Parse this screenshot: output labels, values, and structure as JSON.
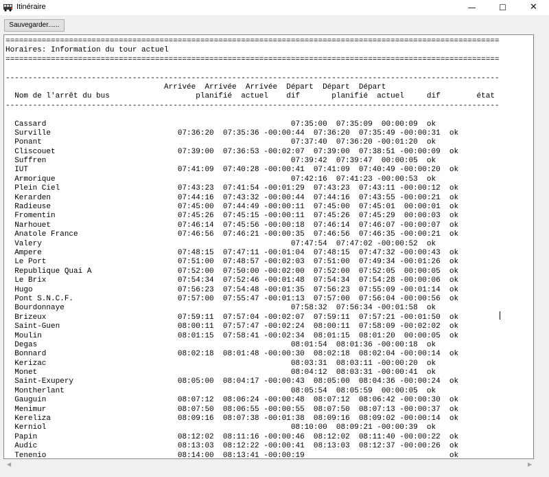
{
  "window": {
    "title": "Itinéraire",
    "minimize": "—",
    "maximize": "☐",
    "close": "✕"
  },
  "toolbar": {
    "save_label": "Sauvegarder......"
  },
  "report": {
    "lines": [
      "=============================================================================================================",
      "Horaires: Information du tour actuel",
      "=============================================================================================================",
      "",
      "-------------------------------------------------------------------------------------------------------------",
      "                                   Arrivée  Arrivée  Arrivée  Départ  Départ  Départ",
      "  Nom de l'arrêt du bus                   planifié  actuel    dif       planifié  actuel     dif        état",
      "-------------------------------------------------------------------------------------------------------------",
      "",
      "  Cassard                                                      07:35:00  07:35:09  00:00:09  ok",
      "  Surville                            07:36:20  07:35:36 -00:00:44  07:36:20  07:35:49 -00:00:31  ok",
      "  Ponant                                                       07:37:40  07:36:20 -00:01:20  ok",
      "  Cliscouet                           07:39:00  07:36:53 -00:02:07  07:39:00  07:38:51 -00:00:09  ok",
      "  Suffren                                                      07:39:42  07:39:47  00:00:05  ok",
      "  IUT                                 07:41:09  07:40:28 -00:00:41  07:41:09  07:40:49 -00:00:20  ok",
      "  Armorique                                                    07:42:16  07:41:23 -00:00:53  ok",
      "  Plein Ciel                          07:43:23  07:41:54 -00:01:29  07:43:23  07:43:11 -00:00:12  ok",
      "  Kerarden                            07:44:16  07:43:32 -00:00:44  07:44:16  07:43:55 -00:00:21  ok",
      "  Radieuse                            07:45:00  07:44:49 -00:00:11  07:45:00  07:45:01  00:00:01  ok",
      "  Fromentin                           07:45:26  07:45:15 -00:00:11  07:45:26  07:45:29  00:00:03  ok",
      "  Narhouet                            07:46:14  07:45:56 -00:00:18  07:46:14  07:46:07 -00:00:07  ok",
      "  Anatole France                      07:46:56  07:46:21 -00:00:35  07:46:56  07:46:35 -00:00:21  ok",
      "  Valery                                                       07:47:54  07:47:02 -00:00:52  ok",
      "  Ampere                              07:48:15  07:47:11 -00:01:04  07:48:15  07:47:32 -00:00:43  ok",
      "  Le Port                             07:51:00  07:48:57 -00:02:03  07:51:00  07:49:34 -00:01:26  ok",
      "  Republique Quai A                   07:52:00  07:50:00 -00:02:00  07:52:00  07:52:05  00:00:05  ok",
      "  Le Brix                             07:54:34  07:52:46 -00:01:48  07:54:34  07:54:28 -00:00:06  ok",
      "  Hugo                                07:56:23  07:54:48 -00:01:35  07:56:23  07:55:09 -00:01:14  ok",
      "  Pont S.N.C.F.                       07:57:00  07:55:47 -00:01:13  07:57:00  07:56:04 -00:00:56  ok",
      "  Bourdonnaye                                                  07:58:32  07:56:34 -00:01:58  ok",
      "  Brizeux                             07:59:11  07:57:04 -00:02:07  07:59:11  07:57:21 -00:01:50  ok",
      "  Saint-Guen                          08:00:11  07:57:47 -00:02:24  08:00:11  07:58:09 -00:02:02  ok",
      "  Moulin                              08:01:15  07:58:41 -00:02:34  08:01:15  08:01:20  00:00:05  ok",
      "  Degas                                                        08:01:54  08:01:36 -00:00:18  ok",
      "  Bonnard                             08:02:18  08:01:48 -00:00:30  08:02:18  08:02:04 -00:00:14  ok",
      "  Kerizac                                                      08:03:31  08:03:11 -00:00:20  ok",
      "  Monet                                                        08:04:12  08:03:31 -00:00:41  ok",
      "  Saint-Exupery                       08:05:00  08:04:17 -00:00:43  08:05:00  08:04:36 -00:00:24  ok",
      "  Montherlant                                                  08:05:54  08:05:59  00:00:05  ok",
      "  Gauguin                             08:07:12  08:06:24 -00:00:48  08:07:12  08:06:42 -00:00:30  ok",
      "  Menimur                             08:07:50  08:06:55 -00:00:55  08:07:50  08:07:13 -00:00:37  ok",
      "  Kereliza                            08:09:16  08:07:38 -00:01:38  08:09:16  08:09:02 -00:00:14  ok",
      "  Kerniol                                                      08:10:00  08:09:21 -00:00:39  ok",
      "  Papin                               08:12:02  08:11:16 -00:00:46  08:12:02  08:11:40 -00:00:22  ok",
      "  Audic                               08:13:03  08:12:22 -00:00:41  08:13:03  08:12:37 -00:00:26  ok",
      "  Tenenio                             08:14:00  08:13:41 -00:00:19                                ok"
    ]
  },
  "scrollbar": {
    "left_arrow": "◀",
    "right_arrow": "▶"
  }
}
